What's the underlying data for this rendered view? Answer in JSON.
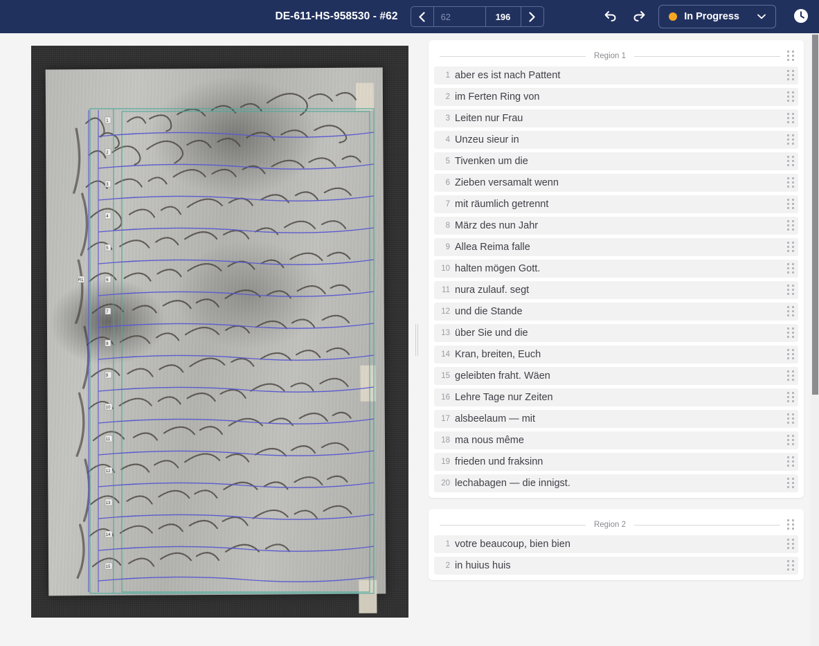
{
  "header": {
    "document_title": "DE-611-HS-958530 - #62",
    "pager": {
      "prev_icon": "chevron-left-icon",
      "next_icon": "chevron-right-icon",
      "current_page_placeholder": "62",
      "current_page_value": "",
      "total_pages": "196"
    },
    "undo_icon": "undo-arrow-icon",
    "redo_icon": "redo-arrow-icon",
    "status": {
      "label": "In Progress",
      "dot_color": "#f5a623",
      "caret_icon": "chevron-down-icon"
    },
    "history_icon": "clock-icon",
    "background_color": "#21315e"
  },
  "image_viewer": {
    "name": "manuscript-page-image",
    "baseline_color": "#5a5ad0",
    "region_box_color": "#4aa99a"
  },
  "transcription": {
    "regions": [
      {
        "title": "Region 1",
        "drag_handle_icon": "drag-handle-icon",
        "lines": [
          {
            "number": "1",
            "text": "aber es ist nach Pattent"
          },
          {
            "number": "2",
            "text": "im Ferten Ring von"
          },
          {
            "number": "3",
            "text": "Leiten nur Frau"
          },
          {
            "number": "4",
            "text": "Unzeu sieur in"
          },
          {
            "number": "5",
            "text": "Tivenken um die"
          },
          {
            "number": "6",
            "text": "Zieben versamalt wenn"
          },
          {
            "number": "7",
            "text": "mit räumlich getrennt"
          },
          {
            "number": "8",
            "text": "März des nun Jahr"
          },
          {
            "number": "9",
            "text": "Allea Reima falle"
          },
          {
            "number": "10",
            "text": "halten mögen Gott."
          },
          {
            "number": "11",
            "text": "nura zulauf. segt"
          },
          {
            "number": "12",
            "text": "und die Stande"
          },
          {
            "number": "13",
            "text": "über Sie und die"
          },
          {
            "number": "14",
            "text": "Kran, breiten, Euch"
          },
          {
            "number": "15",
            "text": "geleibten fraht. Wäen"
          },
          {
            "number": "16",
            "text": "Lehre Tage nur Zeiten"
          },
          {
            "number": "17",
            "text": "alsbeelaum — mit"
          },
          {
            "number": "18",
            "text": "ma nous même"
          },
          {
            "number": "19",
            "text": "frieden und fraksinn"
          },
          {
            "number": "20",
            "text": "lechabagen — die innigst."
          }
        ]
      },
      {
        "title": "Region 2",
        "drag_handle_icon": "drag-handle-icon",
        "lines": [
          {
            "number": "1",
            "text": "votre beaucoup, bien bien"
          },
          {
            "number": "2",
            "text": "in huius huis"
          }
        ]
      }
    ]
  }
}
